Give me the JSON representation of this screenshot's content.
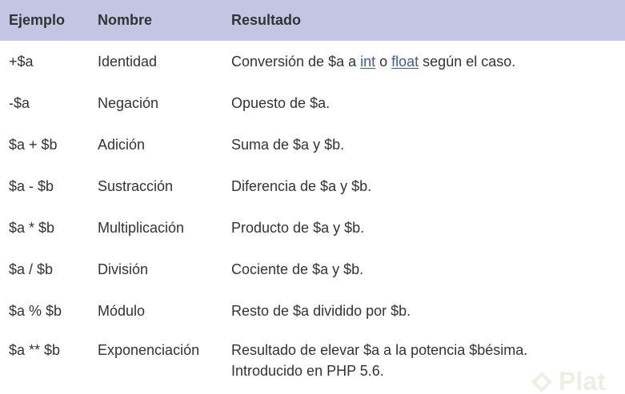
{
  "table": {
    "headers": [
      "Ejemplo",
      "Nombre",
      "Resultado"
    ],
    "rows": [
      {
        "example": "+$a",
        "name": "Identidad",
        "result_pre": "Conversión de $a a ",
        "link1": "int",
        "result_mid": " o ",
        "link2": "float",
        "result_post": " según el caso."
      },
      {
        "example": "-$a",
        "name": "Negación",
        "result": "Opuesto de $a."
      },
      {
        "example": "$a + $b",
        "name": "Adición",
        "result": "Suma de $a y $b."
      },
      {
        "example": "$a - $b",
        "name": "Sustracción",
        "result": "Diferencia de $a y $b."
      },
      {
        "example": "$a * $b",
        "name": "Multiplicación",
        "result": "Producto de $a y $b."
      },
      {
        "example": "$a / $b",
        "name": "División",
        "result": "Cociente de $a y $b."
      },
      {
        "example": "$a % $b",
        "name": "Módulo",
        "result": "Resto de $a dividido por $b."
      },
      {
        "example": "$a ** $b",
        "name": "Exponenciación",
        "result_line1": "Resultado de elevar $a a la potencia $bésima.",
        "result_line2": "Introducido en PHP 5.6."
      }
    ]
  },
  "watermark": {
    "text": "Plat",
    "icon": "platzi-logo-icon",
    "color": "#6a8f2a"
  },
  "colors": {
    "header_bg": "#c4c5e2",
    "link": "#3f5aa3",
    "text": "#333333"
  }
}
